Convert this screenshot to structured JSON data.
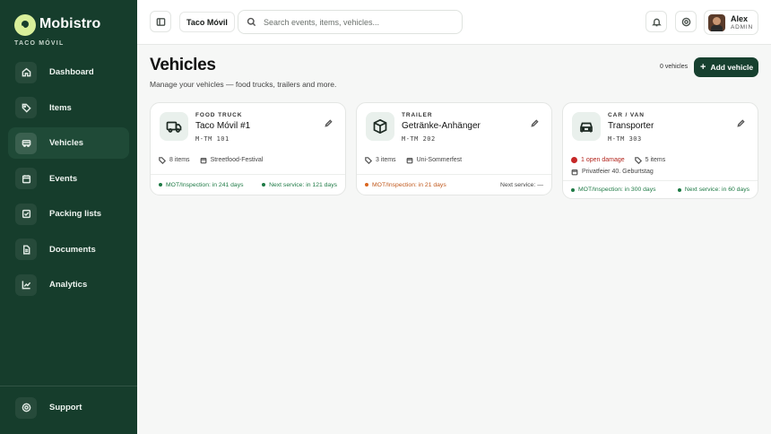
{
  "brand": {
    "name": "Mobistro",
    "subtitle": "TACO MÓVIL"
  },
  "sidebar": {
    "items": [
      {
        "label": "Dashboard",
        "icon": "home-icon"
      },
      {
        "label": "Items",
        "icon": "tag-icon"
      },
      {
        "label": "Vehicles",
        "icon": "bus-icon",
        "active": true
      },
      {
        "label": "Events",
        "icon": "calendar-icon"
      },
      {
        "label": "Packing lists",
        "icon": "checklist-icon"
      },
      {
        "label": "Documents",
        "icon": "document-icon"
      },
      {
        "label": "Analytics",
        "icon": "chart-icon"
      }
    ],
    "support": {
      "label": "Support",
      "icon": "help-circle-icon"
    }
  },
  "topbar": {
    "org": "Taco Móvil",
    "search_placeholder": "Search events, items, vehicles...",
    "user": {
      "name": "Alex",
      "role": "ADMIN"
    }
  },
  "page": {
    "title": "Vehicles",
    "subtitle": "Manage your vehicles — food trucks, trailers and more.",
    "vehicle_count": "0 vehicles",
    "add_button": "Add vehicle"
  },
  "vehicles": [
    {
      "type": "FOOD TRUCK",
      "name": "Taco Móvil #1",
      "plate": "M-TM 101",
      "icon": "truck-icon",
      "items": "8 items",
      "event": "Streetfood-Festival",
      "mot": "MOT/Inspection: in 241 days",
      "service": "Next service: in 121 days"
    },
    {
      "type": "TRAILER",
      "name": "Getränke-Anhänger",
      "plate": "M-TM 202",
      "icon": "box-icon",
      "items": "3 items",
      "event": "Uni-Sommerfest",
      "mot": "MOT/Inspection: in 21 days",
      "service": "Next service: —"
    },
    {
      "type": "CAR / VAN",
      "name": "Transporter",
      "plate": "M-TM 303",
      "icon": "car-icon",
      "damage": "1 open damage",
      "items": "5 items",
      "event": "Privatfeier 40. Geburtstag",
      "mot": "MOT/Inspection: in 300 days",
      "service": "Next service: in 60 days"
    }
  ],
  "colors": {
    "sidebar": "#163d2c",
    "accent": "#17402f",
    "ok": "#1e7a45",
    "warn": "#d9661f",
    "danger": "#c62828"
  }
}
